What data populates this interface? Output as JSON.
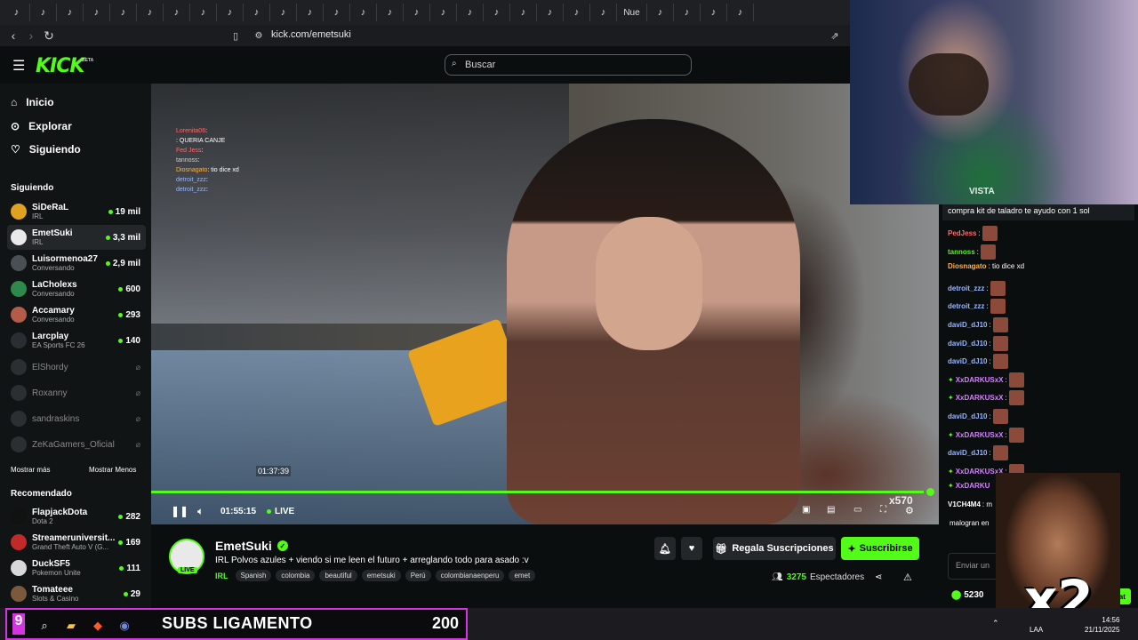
{
  "browser": {
    "tabs": [
      "♪",
      "♪",
      "♪",
      "♪",
      "♪",
      "♪",
      "♪",
      "♪",
      "♪",
      "♪",
      "♪",
      "♪",
      "♪",
      "♪",
      "♪",
      "♪",
      "♪",
      "♪",
      "♪",
      "♪",
      "♪",
      "♪",
      "♪",
      "Nue",
      "♪",
      "♪",
      "♪",
      "♪"
    ],
    "url": "kick.com/emetsuki"
  },
  "header": {
    "logo": "KICK",
    "beta": "BETA",
    "search_placeholder": "Buscar"
  },
  "sidebar": {
    "nav": [
      {
        "icon": "home-icon",
        "label": "Inicio"
      },
      {
        "icon": "compass-icon",
        "label": "Explorar"
      },
      {
        "icon": "heart-icon",
        "label": "Siguiendo"
      }
    ],
    "following_title": "Siguiendo",
    "following": [
      {
        "name": "SiDeRaL",
        "category": "IRL",
        "viewers": "19 mil",
        "color": "#e0a021"
      },
      {
        "name": "EmetSuki",
        "category": "IRL",
        "viewers": "3,3 mil",
        "color": "#e9e9ea"
      },
      {
        "name": "Luisormenoa27",
        "category": "Conversando",
        "viewers": "2,9 mil",
        "color": "#4a4f54"
      },
      {
        "name": "LaCholexs",
        "category": "Conversando",
        "viewers": "600",
        "color": "#2d8a4b"
      },
      {
        "name": "Accamary",
        "category": "Conversando",
        "viewers": "293",
        "color": "#b45c4a"
      },
      {
        "name": "Larcplay",
        "category": "EA Sports FC 26",
        "viewers": "140",
        "color": "#2a2e33"
      }
    ],
    "offline": [
      {
        "name": "ElShordy",
        "color": "#3e4144"
      },
      {
        "name": "Roxanny",
        "color": "#3e4144"
      },
      {
        "name": "sandraskins",
        "color": "#3e4144"
      },
      {
        "name": "ZeKaGamers_Oficial",
        "color": "#3e4144"
      }
    ],
    "show_more": "Mostrar más",
    "show_less": "Mostrar Menos",
    "recommended_title": "Recomendado",
    "recommended": [
      {
        "name": "FlapjackDota",
        "category": "Dota 2",
        "viewers": "282",
        "color": "#111"
      },
      {
        "name": "Streameruniversit...",
        "category": "Grand Theft Auto V (G...",
        "viewers": "169",
        "color": "#c22a2a"
      },
      {
        "name": "DuckSF5",
        "category": "Pokemon Unite",
        "viewers": "111",
        "color": "#d8d8d8"
      },
      {
        "name": "Tomateee",
        "category": "Slots & Casino",
        "viewers": "29",
        "color": "#7a5a3a"
      }
    ]
  },
  "video": {
    "overlay_chat": [
      {
        "user": "Lorenita06",
        "text": ":",
        "color": "#ff6a6a"
      },
      {
        "user": "",
        "text": ": QUERIA CANJE",
        "color": "#53fc18"
      },
      {
        "user": "Fed Jess",
        "text": ":",
        "color": "#ff6a6a"
      },
      {
        "user": "tannoss",
        "text": ":",
        "color": "#cfcfcf"
      },
      {
        "user": "Diosnagato",
        "text": ": tio dice xd",
        "color": "#ffb347"
      },
      {
        "user": "detroit_zzz",
        "text": ":",
        "color": "#9ab7ff"
      },
      {
        "user": "detroit_zzz",
        "text": ":",
        "color": "#9ab7ff"
      }
    ],
    "hover_time": "01:37:39",
    "time": "01:55:15",
    "live_label": "LIVE",
    "quality_badge": "x570",
    "progress_fraction": 0.99
  },
  "stream": {
    "name": "EmetSuki",
    "live_badge": "LIVE",
    "title": "IRL Polvos azules + viendo si me leen el futuro + arreglando todo para asado :v",
    "category": "IRL",
    "tags": [
      "Spanish",
      "colombia",
      "beautiful",
      "emetsuki",
      "Perú",
      "colombianaenperu",
      "emet"
    ],
    "gift_label": "Regala Suscripciones",
    "subscribe_label": "Suscribirse",
    "viewers_count": "3275",
    "viewers_label": "Espectadores"
  },
  "chat": {
    "pinned": "compra kit de taladro te ayudo con 1 sol",
    "messages": [
      {
        "user": "PedJess",
        "text": ":",
        "color": "#ff6a6a",
        "badge": false
      },
      {
        "user": "tannoss",
        "text": ":",
        "color": "#53fc18",
        "badge": false
      },
      {
        "user": "Diosnagato",
        "text": ": tio dice xd",
        "color": "#ffb347",
        "badge": false
      },
      {
        "user": "detroit_zzz",
        "text": ":",
        "color": "#9ab7ff",
        "badge": false
      },
      {
        "user": "detroit_zzz",
        "text": ":",
        "color": "#9ab7ff",
        "badge": false
      },
      {
        "user": "daviD_dJ10",
        "text": ":",
        "color": "#9ab7ff",
        "badge": false
      },
      {
        "user": "daviD_dJ10",
        "text": ":",
        "color": "#9ab7ff",
        "badge": false
      },
      {
        "user": "daviD_dJ10",
        "text": ":",
        "color": "#9ab7ff",
        "badge": false
      },
      {
        "user": "XxDARKUSxX",
        "text": ":",
        "color": "#d580ff",
        "badge": true
      },
      {
        "user": "XxDARKUSxX",
        "text": ":",
        "color": "#d580ff",
        "badge": true
      },
      {
        "user": "daviD_dJ10",
        "text": ":",
        "color": "#9ab7ff",
        "badge": false
      },
      {
        "user": "XxDARKUSxX",
        "text": ":",
        "color": "#d580ff",
        "badge": true
      },
      {
        "user": "daviD_dJ10",
        "text": ":",
        "color": "#9ab7ff",
        "badge": false
      },
      {
        "user": "XxDARKUSxX",
        "text": ":",
        "color": "#d580ff",
        "badge": true
      },
      {
        "user": "XxDARKU",
        "text": "",
        "color": "#d580ff",
        "badge": true
      },
      {
        "user": "V1CH4M4",
        "text": ": m",
        "color": "#ffffff",
        "badge": false
      },
      {
        "user": "",
        "text": "malogran en",
        "color": "#ffffff",
        "badge": false
      }
    ],
    "input_placeholder": "Enviar un",
    "points": "5230",
    "send_label": "Chat"
  },
  "webcam": {
    "jersey_text": "VISTA"
  },
  "meme": {
    "text": "x2"
  },
  "taskbar": {
    "goal_number": "9",
    "goal_label": "SUBS LIGAMENTO",
    "goal_count": "200",
    "lang": "LAA",
    "time": "14:56",
    "date": "21/11/2025"
  },
  "colors": {
    "accent": "#53fc18",
    "background": "#0b0e0f",
    "sidebar": "#111415",
    "goal_border": "#d535e0"
  }
}
